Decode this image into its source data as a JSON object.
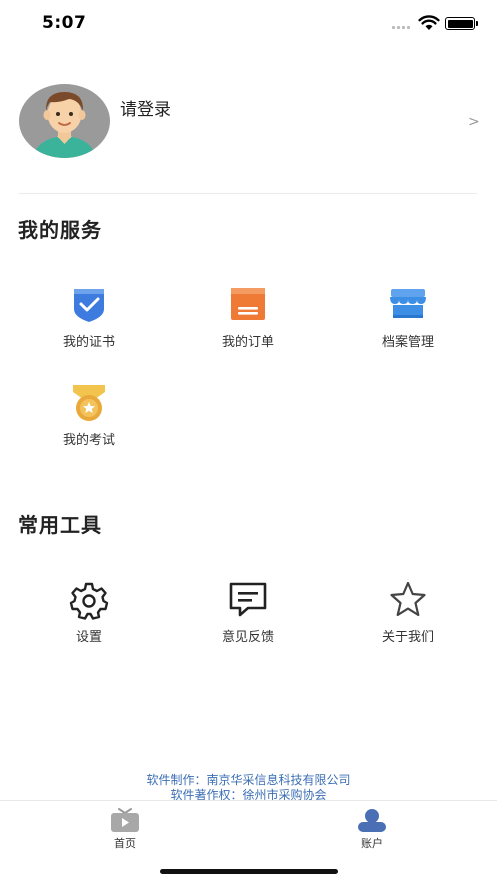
{
  "status_bar": {
    "time": "5:07"
  },
  "profile": {
    "login_text": "请登录",
    "chevron": ">"
  },
  "services": {
    "title": "我的服务",
    "items": [
      {
        "label": "我的证书",
        "icon": "certificate-icon",
        "color": "#3d7bde"
      },
      {
        "label": "我的订单",
        "icon": "order-icon",
        "color": "#ee7a35"
      },
      {
        "label": "档案管理",
        "icon": "archive-store-icon",
        "color": "#3d8fe6"
      },
      {
        "label": "我的考试",
        "icon": "exam-medal-icon",
        "color": "#e8a93a"
      }
    ]
  },
  "tools": {
    "title": "常用工具",
    "items": [
      {
        "label": "设置",
        "icon": "gear-icon"
      },
      {
        "label": "意见反馈",
        "icon": "feedback-icon"
      },
      {
        "label": "关于我们",
        "icon": "star-icon"
      }
    ]
  },
  "footer": {
    "line1": "软件制作：南京华采信息科技有限公司",
    "line2": "软件著作权：徐州市采购协会"
  },
  "tabbar": {
    "home_label": "首页",
    "account_label": "账户",
    "active_color": "#4a6fb5"
  }
}
